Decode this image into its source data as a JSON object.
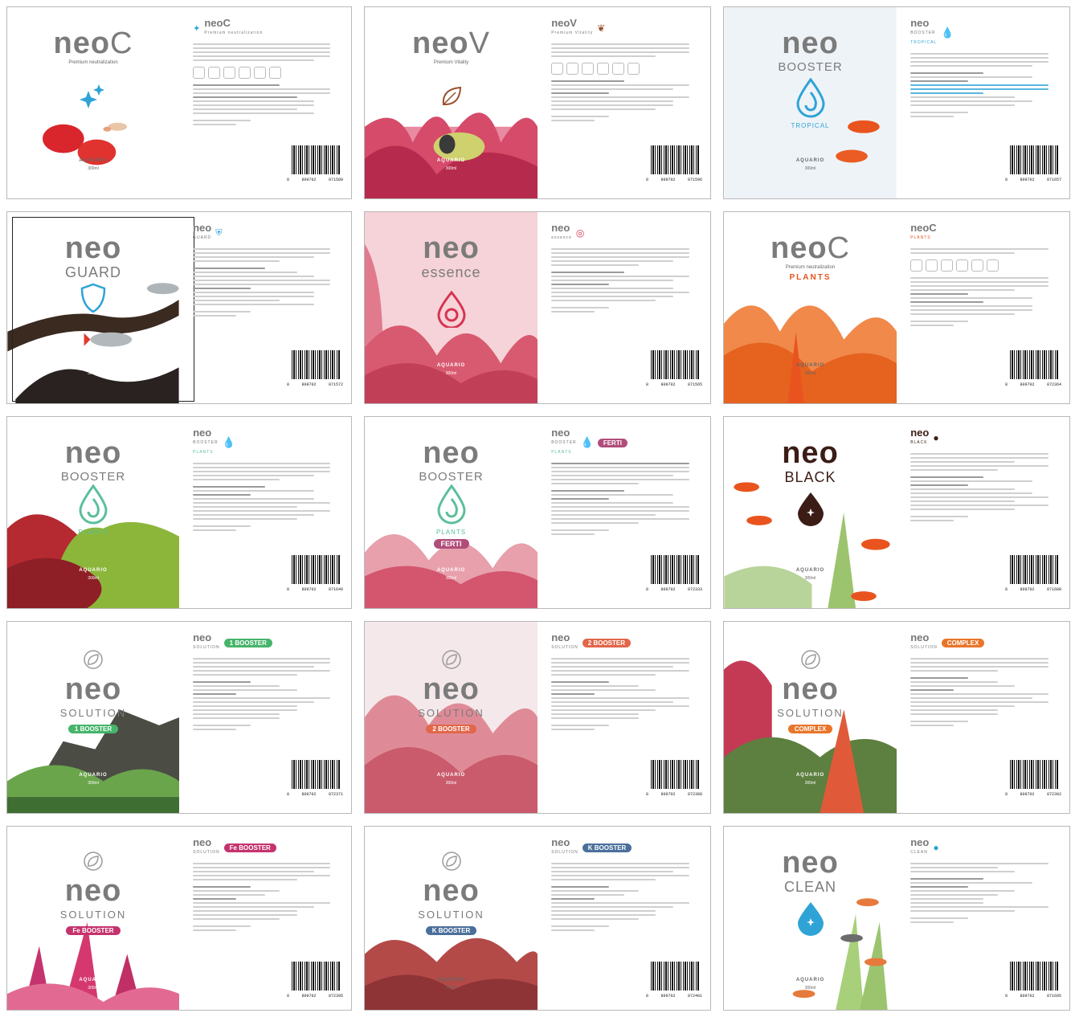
{
  "colors": {
    "grey_logo": "#7b7b7b",
    "blue_accent": "#2fa3d6",
    "teal_accent": "#5bbf9a",
    "brown_accent": "#9a4e2c",
    "red_accent": "#d6344f",
    "orange_accent": "#e9541e",
    "pink_accent": "#b14d7a",
    "green_accent": "#46b46a",
    "coral_accent": "#e2664a",
    "magenta_accent": "#c5336e",
    "steel_accent": "#4b6f9b",
    "black_accent": "#3b1d16"
  },
  "labels": [
    {
      "id": "neo-c",
      "neo": "neo",
      "product_letter": "C",
      "tagline": "Premium neutralization",
      "maker": "AQUARIO",
      "volume": "300ml",
      "mini_brand": "neoC",
      "mini_tag": "Premium neutralization",
      "emblem": "sparkle-icon",
      "barcode_digits": [
        "8",
        "809702",
        "871589"
      ]
    },
    {
      "id": "neo-v",
      "neo": "neo",
      "product_letter": "V",
      "tagline": "Premium Vitality",
      "maker": "AQUARIO",
      "volume": "300ml",
      "mini_brand": "neoV",
      "mini_tag": "Premium Vitality",
      "emblem": "leaf-icon",
      "barcode_digits": [
        "8",
        "809702",
        "871596"
      ]
    },
    {
      "id": "neo-booster-tropical",
      "neo": "neo",
      "subtitle": "BOOSTER",
      "variant": "TROPICAL",
      "maker": "AQUARIO",
      "volume": "300ml",
      "mini_brand": "neo",
      "mini_tag": "BOOSTER",
      "mini_variant": "TROPICAL",
      "emblem": "drop-swirl-icon",
      "barcode_digits": [
        "8",
        "809702",
        "871657"
      ]
    },
    {
      "id": "neo-guard",
      "neo": "neo",
      "subtitle": "GUARD",
      "maker": "AQUARIO",
      "volume": "300ml",
      "mini_brand": "neo",
      "mini_tag": "GUARD",
      "emblem": "shield-icon",
      "barcode_digits": [
        "8",
        "809702",
        "871572"
      ]
    },
    {
      "id": "neo-essence",
      "neo": "neo",
      "subtitle": "essence",
      "maker": "AQUARIO",
      "volume": "300ml",
      "mini_brand": "neo",
      "mini_tag": "essence",
      "emblem": "drop-rings-icon",
      "barcode_digits": [
        "8",
        "809702",
        "871565"
      ]
    },
    {
      "id": "neo-c-plants",
      "neo": "neo",
      "product_letter": "C",
      "tagline": "Premium neutralization",
      "variant": "PLANTS",
      "maker": "AQUARIO",
      "volume": "300ml",
      "mini_brand": "neoC",
      "mini_tag": "PLANTS",
      "barcode_digits": [
        "8",
        "809702",
        "872364"
      ]
    },
    {
      "id": "neo-booster-plants",
      "neo": "neo",
      "subtitle": "BOOSTER",
      "variant": "PLANTS",
      "maker": "AQUARIO",
      "volume": "300ml",
      "mini_brand": "neo",
      "mini_tag": "BOOSTER",
      "mini_variant": "PLANTS",
      "emblem": "drop-swirl-icon",
      "barcode_digits": [
        "8",
        "809702",
        "871640"
      ]
    },
    {
      "id": "neo-booster-ferti",
      "neo": "neo",
      "subtitle": "BOOSTER",
      "variant": "PLANTS",
      "pill": "FERTI",
      "maker": "AQUARIO",
      "volume": "300ml",
      "mini_brand": "neo",
      "mini_tag": "BOOSTER",
      "mini_variant": "PLANTS",
      "mini_pill": "FERTI",
      "emblem": "drop-swirl-icon",
      "barcode_digits": [
        "8",
        "809702",
        "872333"
      ]
    },
    {
      "id": "neo-black",
      "neo": "neo",
      "subtitle": "BLACK",
      "maker": "AQUARIO",
      "volume": "300ml",
      "mini_brand": "neo",
      "mini_tag": "BLACK",
      "emblem": "black-drop-icon",
      "barcode_digits": [
        "8",
        "809702",
        "871688"
      ]
    },
    {
      "id": "neo-solution-1",
      "neo": "neo",
      "subtitle": "SOLUTION",
      "pill_num": "1",
      "pill": "BOOSTER",
      "maker": "AQUARIO",
      "volume": "300ml",
      "mini_brand": "neo",
      "mini_tag": "SOLUTION",
      "emblem": "leaf-circle-icon",
      "barcode_digits": [
        "8",
        "809702",
        "872371"
      ]
    },
    {
      "id": "neo-solution-2",
      "neo": "neo",
      "subtitle": "SOLUTION",
      "pill_num": "2",
      "pill": "BOOSTER",
      "maker": "AQUARIO",
      "volume": "300ml",
      "mini_brand": "neo",
      "mini_tag": "SOLUTION",
      "emblem": "leaf-circle-icon",
      "barcode_digits": [
        "8",
        "809702",
        "872388"
      ]
    },
    {
      "id": "neo-solution-complex",
      "neo": "neo",
      "subtitle": "SOLUTION",
      "pill": "COMPLEX",
      "maker": "AQUARIO",
      "volume": "300ml",
      "mini_brand": "neo",
      "mini_tag": "SOLUTION",
      "emblem": "leaf-circle-icon",
      "barcode_digits": [
        "8",
        "809702",
        "872302"
      ]
    },
    {
      "id": "neo-solution-fe",
      "neo": "neo",
      "subtitle": "SOLUTION",
      "pill_num": "Fe",
      "pill": "BOOSTER",
      "maker": "AQUARIO",
      "volume": "300ml",
      "mini_brand": "neo",
      "mini_tag": "SOLUTION",
      "emblem": "leaf-circle-icon",
      "barcode_digits": [
        "8",
        "809702",
        "872395"
      ]
    },
    {
      "id": "neo-solution-k",
      "neo": "neo",
      "subtitle": "SOLUTION",
      "pill_num": "K",
      "pill": "BOOSTER",
      "maker": "AQUARIO",
      "volume": "300ml",
      "mini_brand": "neo",
      "mini_tag": "SOLUTION",
      "emblem": "leaf-circle-icon",
      "barcode_digits": [
        "8",
        "809702",
        "872401"
      ]
    },
    {
      "id": "neo-clean",
      "neo": "neo",
      "subtitle": "CLEAN",
      "maker": "AQUARIO",
      "volume": "300ml",
      "mini_brand": "neo",
      "mini_tag": "CLEAN",
      "emblem": "blue-drop-icon",
      "barcode_digits": [
        "8",
        "809702",
        "871695"
      ]
    }
  ]
}
